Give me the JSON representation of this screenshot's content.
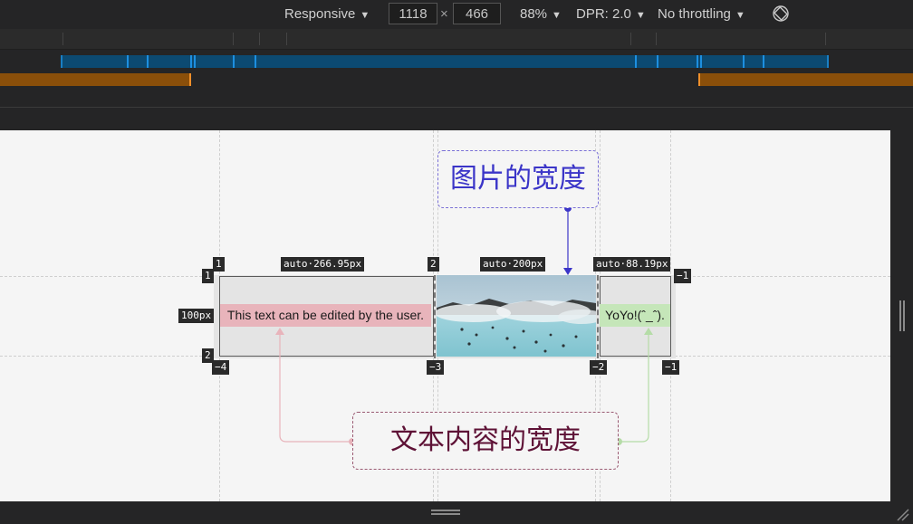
{
  "toolbar": {
    "device_mode": "Responsive",
    "width": "1118",
    "times": "×",
    "height": "466",
    "zoom": "88%",
    "dpr": "DPR: 2.0",
    "throttling": "No throttling",
    "caret": "▼",
    "rotate_icon": "rotate-icon"
  },
  "colors": {
    "toolbar_bg": "#252526",
    "max_width_bar": "#0c4a72",
    "min_width_bar": "#8a4f0a",
    "text_cell": "#e8b4bb",
    "yoyo_cell": "#c5e6b9",
    "callout_top": "#3b35c8",
    "callout_bottom": "#5e1236"
  },
  "page": {
    "text_cell": "This text can be edited by the user.",
    "yoyo_cell": "YoYo!(ˆ_ˆ).",
    "callout_top": "图片的宽度",
    "callout_bottom": "文本内容的宽度"
  },
  "grid_overlay": {
    "col_sizes": [
      "auto·266.95px",
      "auto·200px",
      "auto·88.19px"
    ],
    "row_size": "100px",
    "col_line_top": [
      "1",
      "2",
      "−1"
    ],
    "col_line_bottom": [
      "−4",
      "−3",
      "−2",
      "−1"
    ],
    "row_line_left": [
      "1",
      "2"
    ]
  }
}
